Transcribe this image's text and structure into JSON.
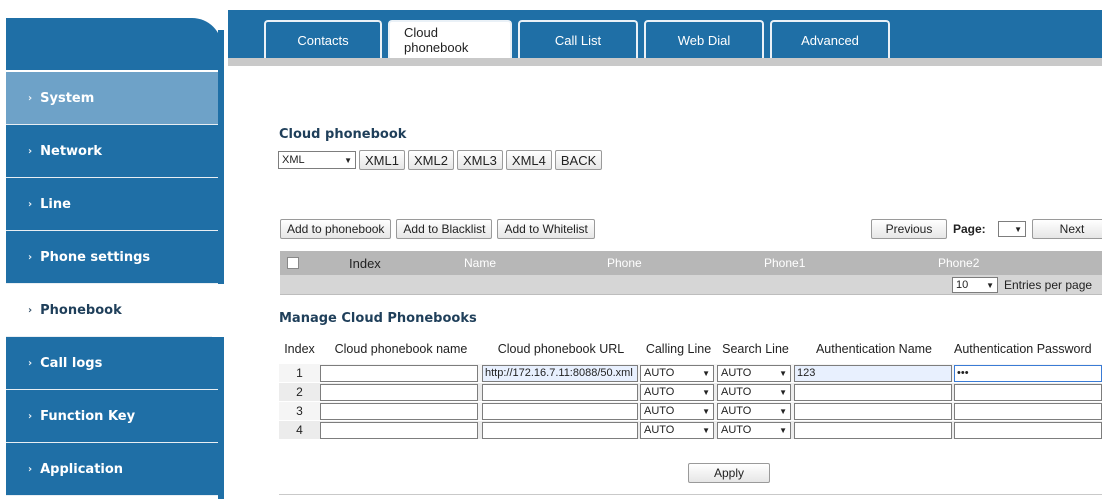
{
  "sidebar": {
    "items": [
      {
        "label": "System"
      },
      {
        "label": "Network"
      },
      {
        "label": "Line"
      },
      {
        "label": "Phone settings"
      },
      {
        "label": "Phonebook"
      },
      {
        "label": "Call logs"
      },
      {
        "label": "Function Key"
      },
      {
        "label": "Application"
      }
    ],
    "active_item": "Phonebook"
  },
  "tabs": [
    {
      "label": "Contacts"
    },
    {
      "label": "Cloud phonebook"
    },
    {
      "label": "Call List"
    },
    {
      "label": "Web Dial"
    },
    {
      "label": "Advanced"
    }
  ],
  "active_tab": "Cloud phonebook",
  "cloud_phonebook": {
    "title": "Cloud phonebook",
    "type_select": "XML",
    "buttons": [
      "XML1",
      "XML2",
      "XML3",
      "XML4",
      "BACK"
    ]
  },
  "actions": {
    "add_phonebook": "Add to phonebook",
    "add_blacklist": "Add to Blacklist",
    "add_whitelist": "Add to Whitelist",
    "previous": "Previous",
    "page_label": "Page:",
    "page_value": "",
    "next": "Next"
  },
  "list": {
    "columns": [
      "Index",
      "Name",
      "Phone",
      "Phone1",
      "Phone2"
    ],
    "entries_per_page": "10",
    "entries_label": "Entries per page"
  },
  "manage": {
    "title": "Manage Cloud Phonebooks",
    "headers": {
      "index": "Index",
      "name": "Cloud phonebook name",
      "url": "Cloud phonebook URL",
      "calling_line": "Calling Line",
      "search_line": "Search Line",
      "auth_name": "Authentication Name",
      "auth_password": "Authentication Password"
    },
    "rows": [
      {
        "index": "1",
        "name": "",
        "url": "http://172.16.7.11:8088/50.xml",
        "calling": "AUTO",
        "search": "AUTO",
        "auth_name": "123",
        "auth_password": "•••"
      },
      {
        "index": "2",
        "name": "",
        "url": "",
        "calling": "AUTO",
        "search": "AUTO",
        "auth_name": "",
        "auth_password": ""
      },
      {
        "index": "3",
        "name": "",
        "url": "",
        "calling": "AUTO",
        "search": "AUTO",
        "auth_name": "",
        "auth_password": ""
      },
      {
        "index": "4",
        "name": "",
        "url": "",
        "calling": "AUTO",
        "search": "AUTO",
        "auth_name": "",
        "auth_password": ""
      }
    ],
    "apply": "Apply"
  },
  "colors": {
    "nav_blue": "#1f6fa6",
    "nav_selected_light": "#6ea2c8",
    "header_gray": "#b7b7b7"
  },
  "icons": {
    "chevron": "chevron-right-icon",
    "dropdown": "dropdown-arrow-icon",
    "checkbox": "checkbox-icon"
  }
}
